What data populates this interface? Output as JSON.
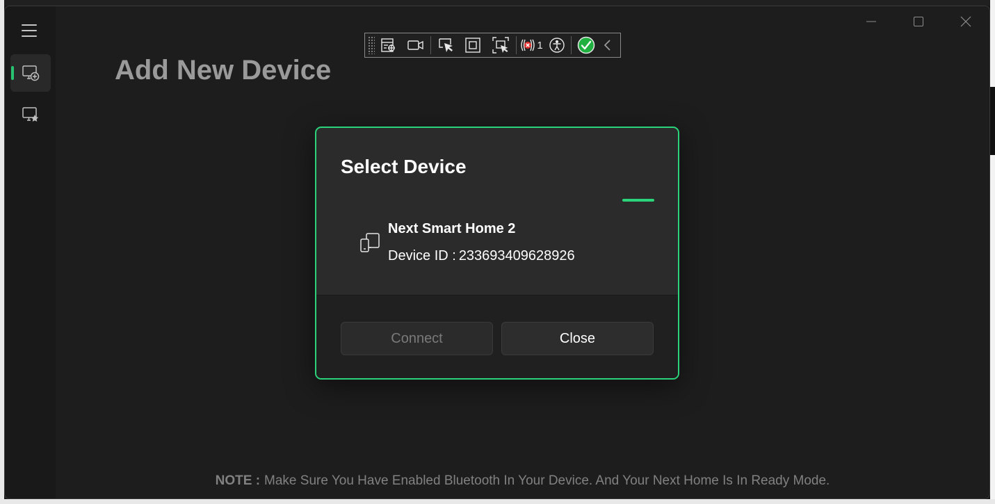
{
  "page": {
    "title": "Add New Device",
    "note_label": "NOTE :",
    "note_text": "Make Sure You Have Enabled Bluetooth In Your Device. And Your Next Home Is In Ready Mode."
  },
  "sidebar": {
    "items": [
      {
        "icon": "hamburger-menu-icon"
      },
      {
        "icon": "add-device-icon",
        "active": true
      },
      {
        "icon": "favorite-devices-icon"
      }
    ]
  },
  "toolbar": {
    "error_count": "1",
    "items": [
      "select-element-icon",
      "record-video-icon",
      "pointer-select-icon",
      "focus-frame-icon",
      "region-select-icon",
      "accessibility-errors-icon",
      "accessibility-icon",
      "check-ok-icon",
      "collapse-chevron-icon"
    ]
  },
  "dialog": {
    "title": "Select Device",
    "device": {
      "name": "Next Smart Home 2",
      "id_label": "Device ID :",
      "id_value": "233693409628926"
    },
    "connect_label": "Connect",
    "close_label": "Close"
  },
  "colors": {
    "accent": "#2bd47a",
    "background": "#202020",
    "dialog": "#2b2b2b"
  }
}
